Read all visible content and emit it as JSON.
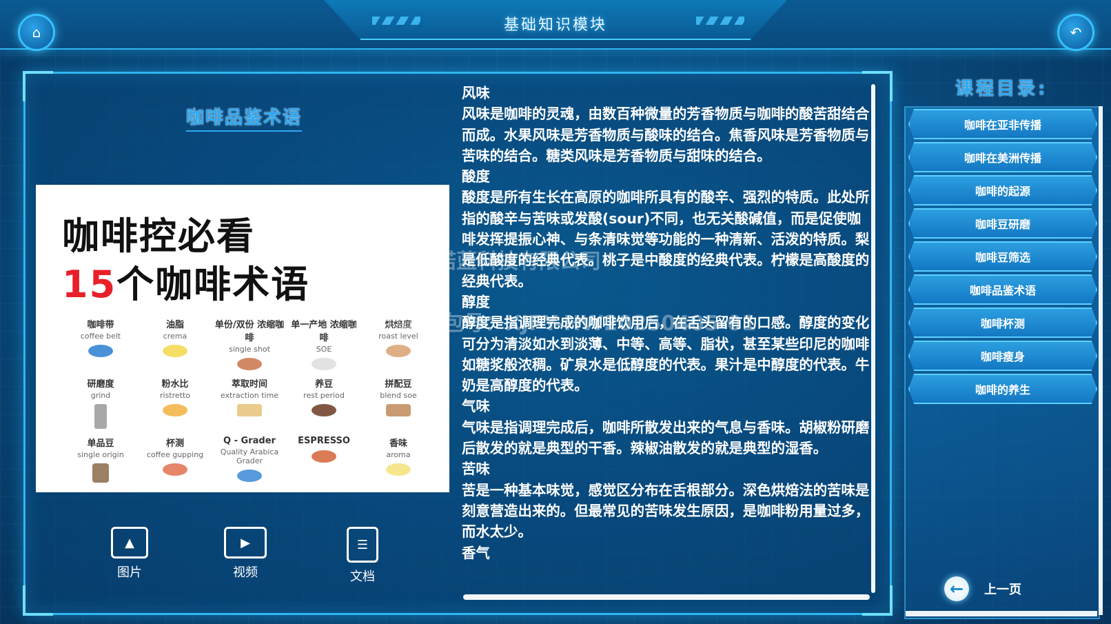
{
  "header": {
    "title": "基础知识模块",
    "home_icon": "⌂",
    "back_icon": "↶"
  },
  "main": {
    "section_title": "咖啡品鉴术语",
    "image_card": {
      "heading_line1": "咖啡控必看",
      "heading_num": "15",
      "heading_line2_rest": "个咖啡术语",
      "terms": [
        {
          "zh": "咖啡带",
          "en": "coffee belt"
        },
        {
          "zh": "油脂",
          "en": "crema"
        },
        {
          "zh": "单份/双份 浓缩咖啡",
          "en": "single shot"
        },
        {
          "zh": "单一产地 浓缩咖啡",
          "en": "SOE"
        },
        {
          "zh": "烘焙度",
          "en": "roast level"
        },
        {
          "zh": "研磨度",
          "en": "grind"
        },
        {
          "zh": "粉水比",
          "en": "ristretto"
        },
        {
          "zh": "萃取时间",
          "en": "extraction time"
        },
        {
          "zh": "养豆",
          "en": "rest period"
        },
        {
          "zh": "拼配豆",
          "en": "blend soe"
        },
        {
          "zh": "单品豆",
          "en": "single origin"
        },
        {
          "zh": "杯测",
          "en": "coffee gupping"
        },
        {
          "zh": "Q - Grader",
          "en": "Quality Arabica Grader"
        },
        {
          "zh": "ESPRESSO",
          "en": ""
        },
        {
          "zh": "香味",
          "en": "aroma"
        }
      ]
    },
    "media": {
      "image_label": "图片",
      "video_label": "视频",
      "doc_label": "文档"
    },
    "paragraphs": [
      "风味",
      "风味是咖啡的灵魂，由数百种微量的芳香物质与咖啡的酸苦甜结合而成。水果风味是芳香物质与酸味的结合。焦香风味是芳香物质与苦味的结合。糖类风味是芳香物质与甜味的结合。",
      "酸度",
      "酸度是所有生长在高原的咖啡所具有的酸辛、强烈的特质。此处所指的酸辛与苦味或发酸(sour)不同，也无关酸碱值，而是促使咖啡发挥提振心神、与条清味觉等功能的一种清新、活泼的特质。梨是低酸度的经典代表。桃子是中酸度的经典代表。柠檬是高酸度的经典代表。",
      "醇度",
      "醇度是指调理完成的咖啡饮用后，在舌头留有的口感。醇度的变化可分为清淡如水到淡薄、中等、高等、脂状，甚至某些印尼的咖啡如糖浆般浓稠。矿泉水是低醇度的代表。果汁是中醇度的代表。牛奶是高醇度的代表。",
      "气味",
      "气味是指调理完成后，咖啡所散发出来的气息与香味。胡椒粉研磨后散发的就是典型的干香。辣椒油散发的就是典型的湿香。",
      "苦味",
      "苦是一种基本味觉，感觉区分布在舌根部分。深色烘焙法的苦味是刻意营造出来的。但最常见的苦味发生原因，是咖啡粉用量过多，而水太少。",
      "香气"
    ],
    "watermark_1": "北京鼎盛诺蓝科技有限公司",
    "watermark_2": "项目编号/包号：XJFY-HW20250405-01"
  },
  "sidebar": {
    "title": "课程目录:",
    "items": [
      "咖啡在亚非传播",
      "咖啡在美洲传播",
      "咖啡的起源",
      "咖啡豆研磨",
      "咖啡豆筛选",
      "咖啡品鉴术语",
      "咖啡杯测",
      "咖啡瘦身",
      "咖啡的养生"
    ],
    "prev_label": "上一页",
    "prev_icon": "←"
  }
}
